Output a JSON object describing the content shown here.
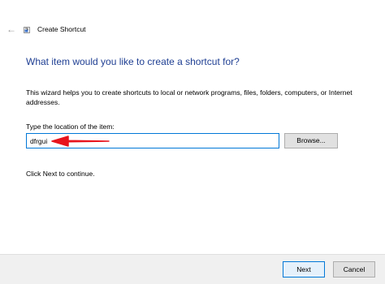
{
  "window": {
    "title": "Create Shortcut",
    "back_icon": "back-arrow-icon",
    "app_icon": "shortcut-wizard-icon"
  },
  "main": {
    "heading": "What item would you like to create a shortcut for?",
    "description": "This wizard helps you to create shortcuts to local or network programs, files, folders, computers, or Internet addresses.",
    "location_label": "Type the location of the item:",
    "location_value": "dfrgui",
    "browse_label": "Browse...",
    "continue_text": "Click Next to continue."
  },
  "footer": {
    "next_label": "Next",
    "cancel_label": "Cancel"
  },
  "colors": {
    "heading": "#1f3f93",
    "focus_border": "#0078d7",
    "annotation_arrow": "#e8141c"
  }
}
